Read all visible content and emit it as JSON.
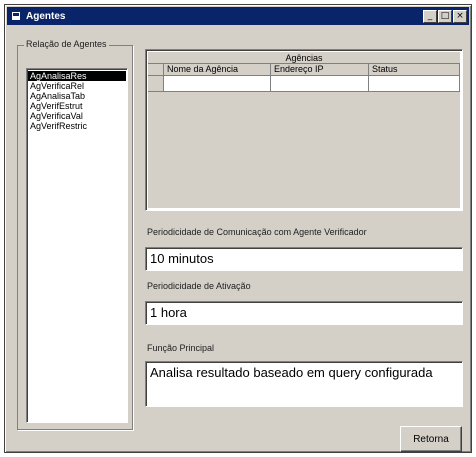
{
  "window": {
    "title": "Agentes",
    "icon": "app-icon",
    "controls": [
      "_",
      "□",
      "×"
    ]
  },
  "agents_group": {
    "label": "Relação de Agentes",
    "items": [
      "AgAnalisaRes",
      "AgVerificaRel",
      "AgAnalisaTab",
      "AgVerifEstrut",
      "AgVerificaVal",
      "AgVerifRestric"
    ],
    "selected_index": 0
  },
  "agencias_grid": {
    "caption": "Agências",
    "columns": [
      "Nome da Agência",
      "Endereço IP",
      "Status"
    ],
    "rows": [
      [
        "",
        "",
        ""
      ]
    ]
  },
  "periodicidade_comunicacao": {
    "label": "Periodicidade de Comunicação com Agente Verificador",
    "value": "10 minutos"
  },
  "periodicidade_ativacao": {
    "label": "Periodicidade de Ativação",
    "value": "1 hora"
  },
  "funcao_principal": {
    "label": "Função Principal",
    "value": "Analisa resultado baseado em query configurada"
  },
  "actions": {
    "retorna_label": "Retorna"
  },
  "colors": {
    "titlebar": "#0a246a",
    "face": "#d4d0c8",
    "selection": "#000000"
  }
}
